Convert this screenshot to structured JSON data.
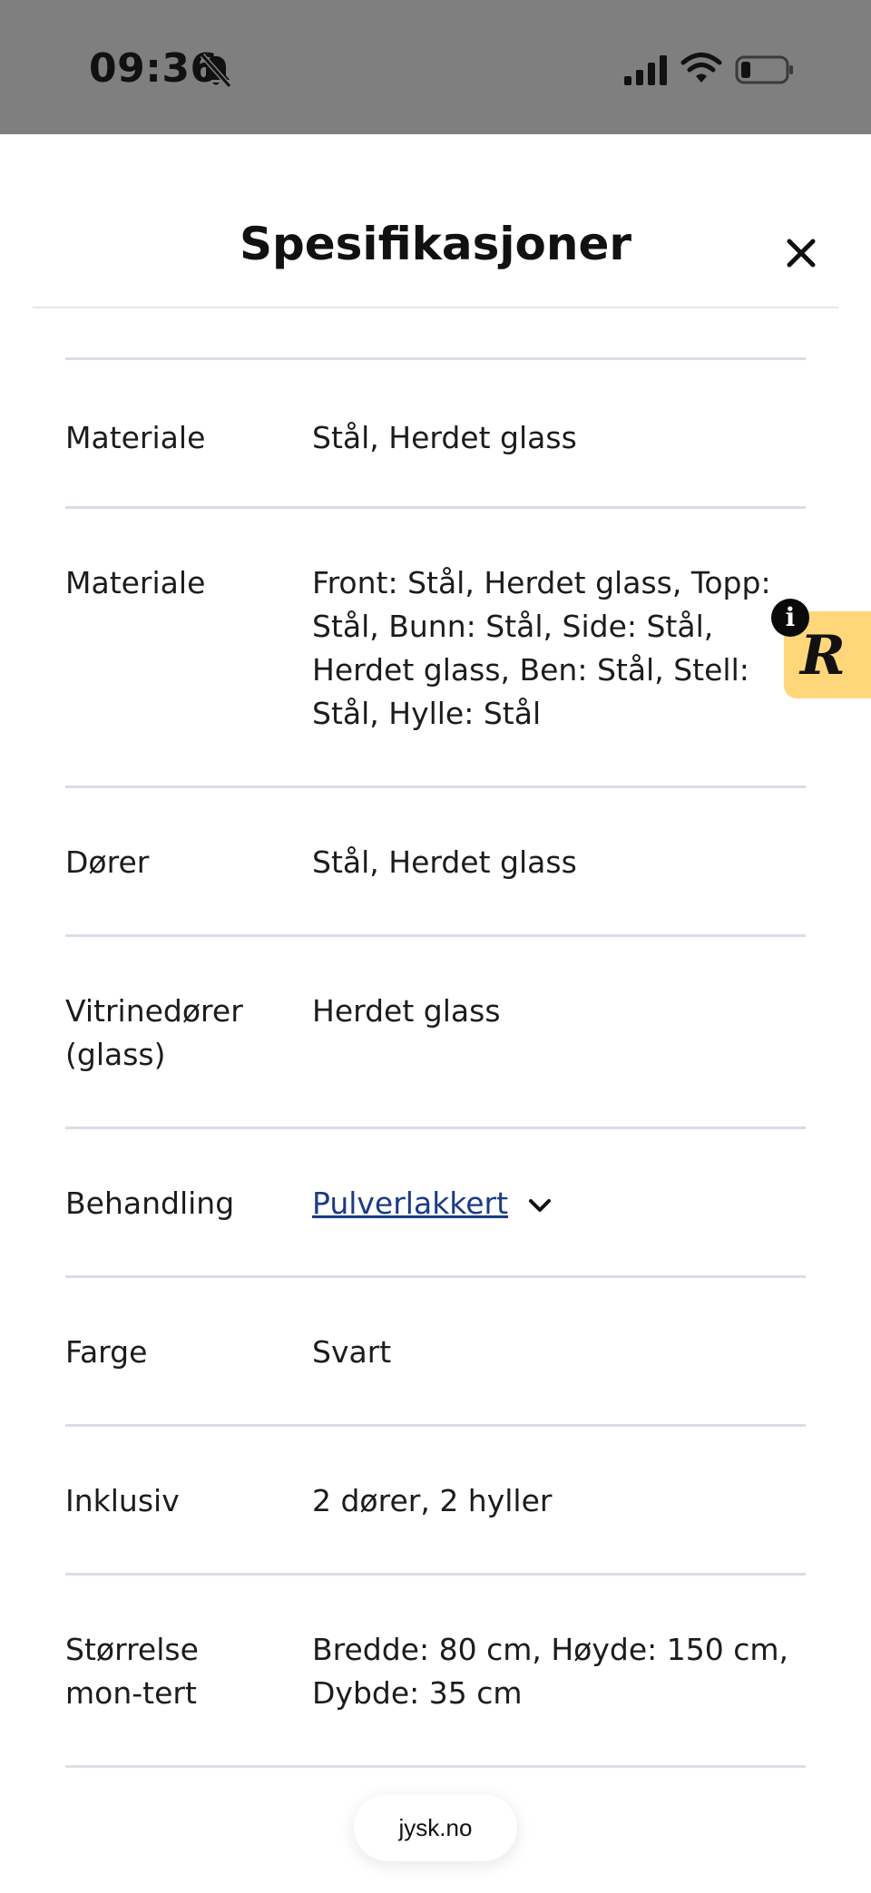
{
  "status_bar": {
    "time": "09:36",
    "icons": [
      "bell-slash-icon",
      "cellular-signal-icon",
      "wifi-icon",
      "battery-low-icon"
    ]
  },
  "sheet": {
    "title": "Spesifikasjoner",
    "close_icon": "close-icon"
  },
  "specs": [
    {
      "label": "Materiale",
      "value": "Stål, Herdet glass"
    },
    {
      "label": "Materiale",
      "value": "Front: Stål, Herdet glass, Topp: Stål, Bunn: Stål, Side: Stål, Herdet glass, Ben: Stål, Stell: Stål, Hylle: Stål"
    },
    {
      "label": "Dører",
      "value": "Stål, Herdet glass"
    },
    {
      "label": "Vitrinedører (glass)",
      "value": "Herdet glass"
    },
    {
      "label": "Behandling",
      "value": "Pulverlakkert",
      "link": true
    },
    {
      "label": "Farge",
      "value": "Svart"
    },
    {
      "label": "Inklusiv",
      "value": "2 dører, 2 hyller"
    },
    {
      "label": "Størrelse mon-tert",
      "value": "Bredde: 80 cm, Høyde: 150 cm, Dybde: 35 cm"
    }
  ],
  "widget": {
    "logo_text": "R",
    "info_label": "i"
  },
  "browser": {
    "url": "jysk.no"
  },
  "colors": {
    "status_bar_bg": "#7f7f7f",
    "link": "#1a3b86",
    "divider": "#d8dde6",
    "widget_bg": "#ffd77a"
  }
}
